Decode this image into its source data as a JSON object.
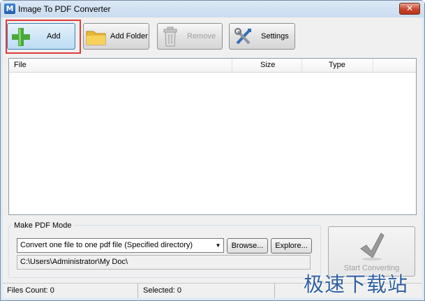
{
  "window": {
    "title": "Image To PDF Converter",
    "app_icon_glyph": "M",
    "close_glyph": "✕"
  },
  "toolbar": {
    "add_label": "Add",
    "add_folder_label": "Add Folder",
    "remove_label": "Remove",
    "settings_label": "Settings"
  },
  "file_list": {
    "columns": [
      "File",
      "Size",
      "Type"
    ],
    "rows": []
  },
  "pdf_mode": {
    "group_label": "Make PDF Mode",
    "selected_mode": "Convert one file to one pdf file (Specified directory)",
    "browse_label": "Browse...",
    "explore_label": "Explore...",
    "output_path": "C:\\Users\\Administrator\\My Doc\\"
  },
  "start": {
    "label": "Start Converting"
  },
  "status": {
    "files_count": "Files Count: 0",
    "selected": "Selected: 0"
  },
  "watermark": {
    "text": "极速下载站"
  },
  "colors": {
    "highlight": "#e03b3b",
    "add_icon": "#4aa83a",
    "title_close": "#c8452d"
  }
}
